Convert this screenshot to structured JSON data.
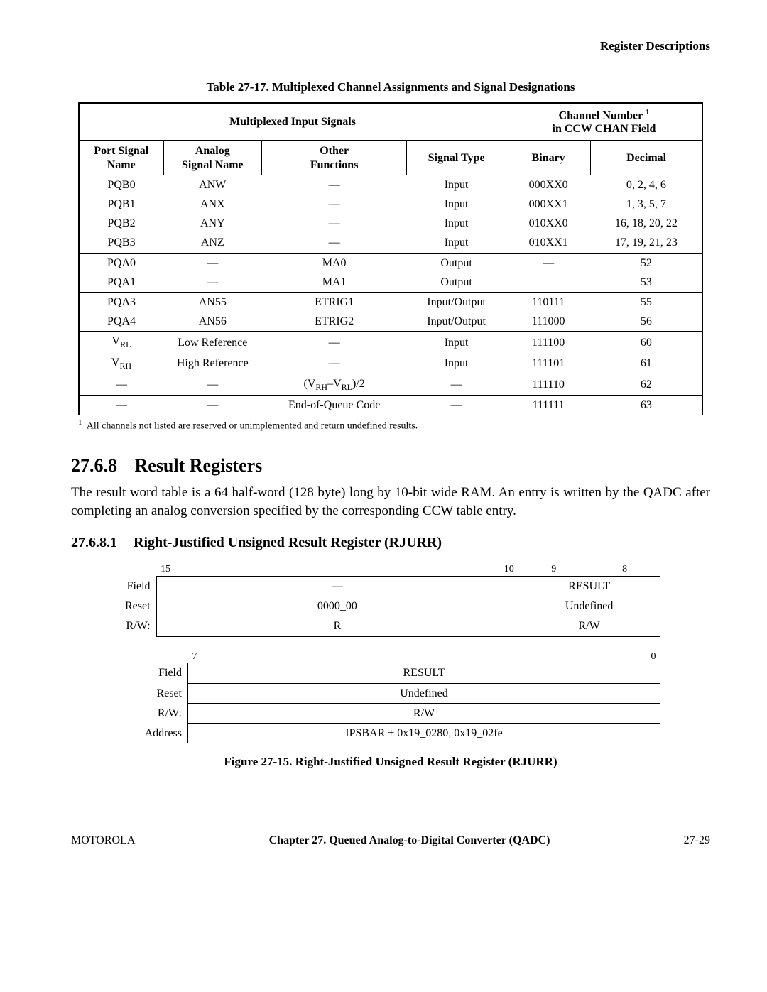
{
  "header": {
    "title": "Register Descriptions"
  },
  "table17": {
    "title": "Table 27-17. Multiplexed Channel Assignments and Signal Designations",
    "head_mux": "Multiplexed Input Signals",
    "head_chan_line1": "Channel Number",
    "head_chan_sup": "1",
    "head_chan_line2": "in CCW CHAN Field",
    "col_port": "Port Signal\nName",
    "col_analog": "Analog\nSignal Name",
    "col_other": "Other\nFunctions",
    "col_sigtype": "Signal Type",
    "col_bin": "Binary",
    "col_dec": "Decimal",
    "g1r1": {
      "port": "PQB0",
      "analog": "ANW",
      "other": "—",
      "sig": "Input",
      "bin": "000XX0",
      "dec": "0, 2, 4, 6"
    },
    "g1r2": {
      "port": "PQB1",
      "analog": "ANX",
      "other": "—",
      "sig": "Input",
      "bin": "000XX1",
      "dec": "1, 3, 5, 7"
    },
    "g1r3": {
      "port": "PQB2",
      "analog": "ANY",
      "other": "—",
      "sig": "Input",
      "bin": "010XX0",
      "dec": "16, 18, 20, 22"
    },
    "g1r4": {
      "port": "PQB3",
      "analog": "ANZ",
      "other": "—",
      "sig": "Input",
      "bin": "010XX1",
      "dec": "17, 19, 21, 23"
    },
    "g2r1": {
      "port": "PQA0",
      "analog": "—",
      "other": "MA0",
      "sig": "Output",
      "bin": "—",
      "dec": "52"
    },
    "g2r2": {
      "port": "PQA1",
      "analog": "—",
      "other": "MA1",
      "sig": "Output",
      "bin": "",
      "dec": "53"
    },
    "g3r1": {
      "port": "PQA3",
      "analog": "AN55",
      "other": "ETRIG1",
      "sig": "Input/Output",
      "bin": "110111",
      "dec": "55"
    },
    "g3r2": {
      "port": "PQA4",
      "analog": "AN56",
      "other": "ETRIG2",
      "sig": "Input/Output",
      "bin": "111000",
      "dec": "56"
    },
    "g4r1": {
      "analog": "Low Reference",
      "other": "—",
      "sig": "Input",
      "bin": "111100",
      "dec": "60"
    },
    "g4r2": {
      "analog": "High Reference",
      "other": "—",
      "sig": "Input",
      "bin": "111101",
      "dec": "61"
    },
    "g4r3": {
      "port": "—",
      "analog": "—",
      "sig": "—",
      "bin": "111110",
      "dec": "62"
    },
    "g5r1": {
      "port": "—",
      "analog": "—",
      "other": "End-of-Queue Code",
      "sig": "—",
      "bin": "111111",
      "dec": "63"
    },
    "footnote_num": "1",
    "footnote": "All channels not listed are reserved or unimplemented and return undefined results."
  },
  "sec": {
    "num": "27.6.8",
    "title": "Result Registers",
    "para": "The result word table is a 64 half-word (128 byte) long by 10-bit wide RAM. An entry is written by the QADC after completing an analog conversion specified by the corresponding CCW table entry."
  },
  "subsec": {
    "num": "27.6.8.1",
    "title": "Right-Justified Unsigned Result Register (RJURR)"
  },
  "reg_upper": {
    "bit_hi": "15",
    "bit_mid": "10",
    "bit_9": "9",
    "bit_8": "8",
    "field_lab": "Field",
    "field_left": "—",
    "field_right": "RESULT",
    "reset_lab": "Reset",
    "reset_left": "0000_00",
    "reset_right": "Undefined",
    "rw_lab": "R/W:",
    "rw_left": "R",
    "rw_right": "R/W"
  },
  "reg_lower": {
    "bit_hi": "7",
    "bit_lo": "0",
    "field_lab": "Field",
    "field": "RESULT",
    "reset_lab": "Reset",
    "reset": "Undefined",
    "rw_lab": "R/W:",
    "rw": "R/W",
    "addr_lab": "Address",
    "addr": "IPSBAR + 0x19_0280, 0x19_02fe"
  },
  "fig_caption": "Figure 27-15. Right-Justified Unsigned Result Register (RJURR)",
  "footer": {
    "left": "MOTOROLA",
    "center": "Chapter 27.  Queued Analog-to-Digital Converter (QADC)",
    "right": "27-29"
  }
}
